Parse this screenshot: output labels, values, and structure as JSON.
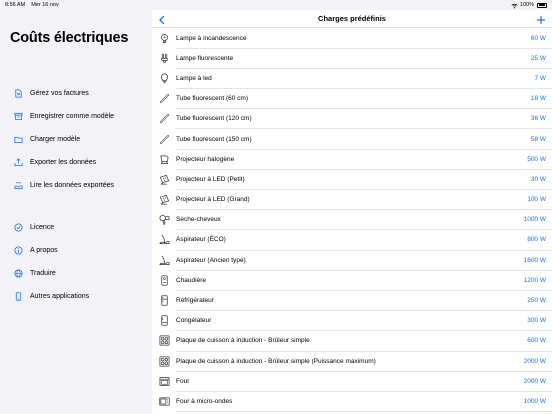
{
  "status": {
    "time": "8:56 AM",
    "date": "Mer 16 nov",
    "battery": "100%"
  },
  "sidebar": {
    "title": "Coûts électriques",
    "group1": [
      {
        "label": "Gérez vos factures",
        "icon": "document-icon"
      },
      {
        "label": "Enregistrer comme modèle",
        "icon": "archive-icon"
      },
      {
        "label": "Charger modèle",
        "icon": "folder-icon"
      },
      {
        "label": "Exporter les données",
        "icon": "export-tray-icon"
      },
      {
        "label": "Lire les données exportées",
        "icon": "import-tray-icon"
      }
    ],
    "group2": [
      {
        "label": "Licence",
        "icon": "check-circle-icon"
      },
      {
        "label": "A propos",
        "icon": "info-circle-icon"
      },
      {
        "label": "Traduire",
        "icon": "globe-icon"
      },
      {
        "label": "Autres applications",
        "icon": "phone-icon"
      }
    ]
  },
  "main": {
    "title": "Charges prédéfinis",
    "rows": [
      {
        "label": "Lampe à incandescence",
        "value": "60 W",
        "icon": "bulb-icon"
      },
      {
        "label": "Lampe fluorescente",
        "value": "25 W",
        "icon": "cfl-bulb-icon"
      },
      {
        "label": "Lampe à led",
        "value": "7 W",
        "icon": "led-bulb-icon"
      },
      {
        "label": "Tube fluorescent (60 cm)",
        "value": "18 W",
        "icon": "tube-icon"
      },
      {
        "label": "Tube fluorescent (120 cm)",
        "value": "36 W",
        "icon": "tube-icon"
      },
      {
        "label": "Tube fluorescent (150 cm)",
        "value": "58 W",
        "icon": "tube-icon"
      },
      {
        "label": "Projecteur halogène",
        "value": "500 W",
        "icon": "projector-icon"
      },
      {
        "label": "Projecteur à LED (Petit)",
        "value": "30 W",
        "icon": "led-projector-icon"
      },
      {
        "label": "Projecteur à LED (Grand)",
        "value": "100 W",
        "icon": "led-projector-icon"
      },
      {
        "label": "Sèche-cheveux",
        "value": "1000 W",
        "icon": "hairdryer-icon"
      },
      {
        "label": "Aspirateur (ÉCO)",
        "value": "800 W",
        "icon": "vacuum-icon"
      },
      {
        "label": "Aspirateur (Ancien type)",
        "value": "1600 W",
        "icon": "vacuum-icon"
      },
      {
        "label": "Chaudière",
        "value": "1200 W",
        "icon": "boiler-icon"
      },
      {
        "label": "Réfrigérateur",
        "value": "250 W",
        "icon": "fridge-icon"
      },
      {
        "label": "Congélateur",
        "value": "300 W",
        "icon": "freezer-icon"
      },
      {
        "label": "Plaque de cuisson à induction - Brûleur simple",
        "value": "600 W",
        "icon": "cooktop-icon"
      },
      {
        "label": "Plaque de cuisson à induction - Brûleur simple (Puissance maximum)",
        "value": "2000 W",
        "icon": "cooktop-icon"
      },
      {
        "label": "Four",
        "value": "2000 W",
        "icon": "oven-icon"
      },
      {
        "label": "Four à micro-ondes",
        "value": "1000 W",
        "icon": "microwave-icon"
      }
    ]
  }
}
